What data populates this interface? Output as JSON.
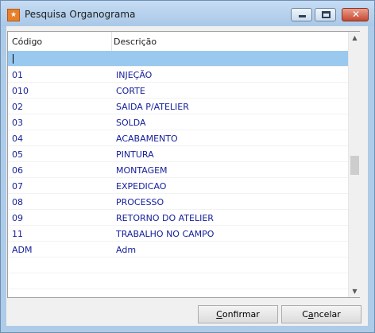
{
  "window": {
    "title": "Pesquisa Organograma",
    "icon": "app-logo-icon",
    "controls": {
      "minimize_icon": "minimize-icon",
      "maximize_icon": "maximize-icon",
      "close_icon": "close-icon",
      "close_glyph": "✕"
    }
  },
  "grid": {
    "columns": [
      "Código",
      "Descrição"
    ],
    "rows": [
      {
        "code": "",
        "desc": ""
      },
      {
        "code": "01",
        "desc": "INJEÇÃO"
      },
      {
        "code": "010",
        "desc": "CORTE"
      },
      {
        "code": "02",
        "desc": "SAIDA P/ATELIER"
      },
      {
        "code": "03",
        "desc": "SOLDA"
      },
      {
        "code": "04",
        "desc": "ACABAMENTO"
      },
      {
        "code": "05",
        "desc": "PINTURA"
      },
      {
        "code": "06",
        "desc": "MONTAGEM"
      },
      {
        "code": "07",
        "desc": "EXPEDICAO"
      },
      {
        "code": "08",
        "desc": "PROCESSO"
      },
      {
        "code": "09",
        "desc": "RETORNO DO ATELIER"
      },
      {
        "code": "11",
        "desc": "TRABALHO NO CAMPO"
      },
      {
        "code": "ADM",
        "desc": "Adm"
      },
      {
        "code": "",
        "desc": ""
      },
      {
        "code": "",
        "desc": ""
      }
    ],
    "selected_row": 0,
    "scroll_up_glyph": "▲",
    "scroll_down_glyph": "▼"
  },
  "buttons": {
    "confirm_first": "C",
    "confirm_rest": "onfirmar",
    "cancel_pre": "C",
    "cancel_under": "a",
    "cancel_rest": "ncelar"
  },
  "colors": {
    "row_text": "#16209a",
    "selection": "#99c9ef"
  }
}
